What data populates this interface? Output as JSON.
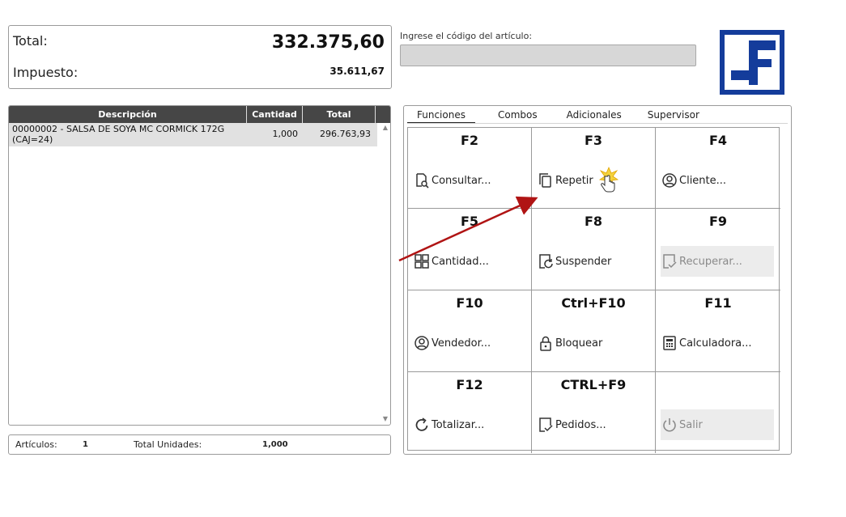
{
  "totals": {
    "total_label": "Total:",
    "total_value": "332.375,60",
    "tax_label": "Impuesto:",
    "tax_value": "35.611,67"
  },
  "code": {
    "label": "Ingrese el código del artículo:",
    "value": ""
  },
  "items_table": {
    "headers": [
      "Descripción",
      "Cantidad",
      "Total"
    ],
    "rows": [
      {
        "descripcion": "00000002 - SALSA DE SOYA MC CORMICK 172G (CAJ=24)",
        "cantidad": "1,000",
        "total": "296.763,93"
      }
    ]
  },
  "summary": {
    "articulos_label": "Artículos:",
    "articulos_value": "1",
    "unidades_label": "Total Unidades:",
    "unidades_value": "1,000"
  },
  "tabs": [
    "Funciones",
    "Combos",
    "Adicionales",
    "Supervisor"
  ],
  "active_tab": "Funciones",
  "functions": [
    {
      "key": "F2",
      "label": "Consultar...",
      "icon": "search-doc-icon",
      "enabled": true
    },
    {
      "key": "F3",
      "label": "Repetir",
      "icon": "copy-icon",
      "enabled": true
    },
    {
      "key": "F4",
      "label": "Cliente...",
      "icon": "user-circle-icon",
      "enabled": true
    },
    {
      "key": "F5",
      "label": "Cantidad...",
      "icon": "grid-icon",
      "enabled": true
    },
    {
      "key": "F8",
      "label": "Suspender",
      "icon": "suspend-icon",
      "enabled": true
    },
    {
      "key": "F9",
      "label": "Recuperar...",
      "icon": "doc-check-icon",
      "enabled": false
    },
    {
      "key": "F10",
      "label": "Vendedor...",
      "icon": "user-circle-icon",
      "enabled": true
    },
    {
      "key": "Ctrl+F10",
      "label": "Bloquear",
      "icon": "lock-icon",
      "enabled": true
    },
    {
      "key": "F11",
      "label": "Calculadora...",
      "icon": "calculator-icon",
      "enabled": true
    },
    {
      "key": "F12",
      "label": "Totalizar...",
      "icon": "refresh-icon",
      "enabled": true
    },
    {
      "key": "CTRL+F9",
      "label": "Pedidos...",
      "icon": "doc-check-icon",
      "enabled": true
    },
    {
      "key": "",
      "label": "Salir",
      "icon": "power-icon",
      "enabled": false
    }
  ],
  "colors": {
    "logo_blue": "#143c9b",
    "table_header": "#464646",
    "arrow": "#b01414"
  }
}
